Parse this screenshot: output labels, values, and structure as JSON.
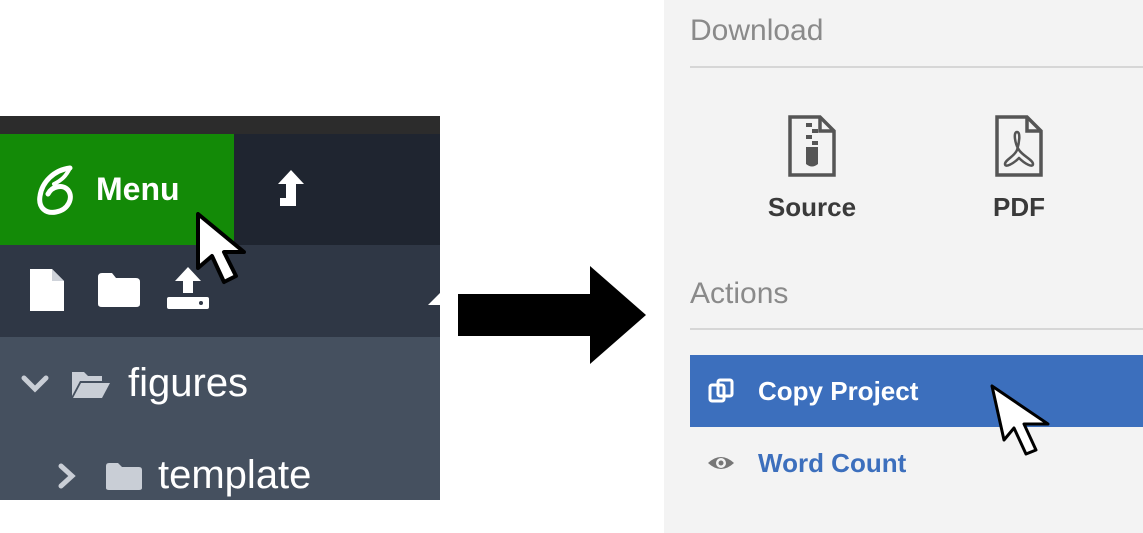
{
  "editor": {
    "menu_label": "Menu",
    "tree": [
      {
        "label": "figures",
        "expanded": true
      },
      {
        "label": "template",
        "expanded": false
      }
    ]
  },
  "panel": {
    "download_title": "Download",
    "download_items": [
      {
        "label": "Source",
        "icon": "zip-file-icon"
      },
      {
        "label": "PDF",
        "icon": "pdf-file-icon"
      }
    ],
    "actions_title": "Actions",
    "actions": [
      {
        "label": "Copy Project",
        "icon": "copy-icon",
        "active": true
      },
      {
        "label": "Word Count",
        "icon": "eye-icon",
        "active": false
      }
    ]
  },
  "colors": {
    "menu_green": "#138a07",
    "active_blue": "#3c6fbd",
    "toolbar_dark": "#2f3745",
    "tree_bg": "#45505f"
  }
}
